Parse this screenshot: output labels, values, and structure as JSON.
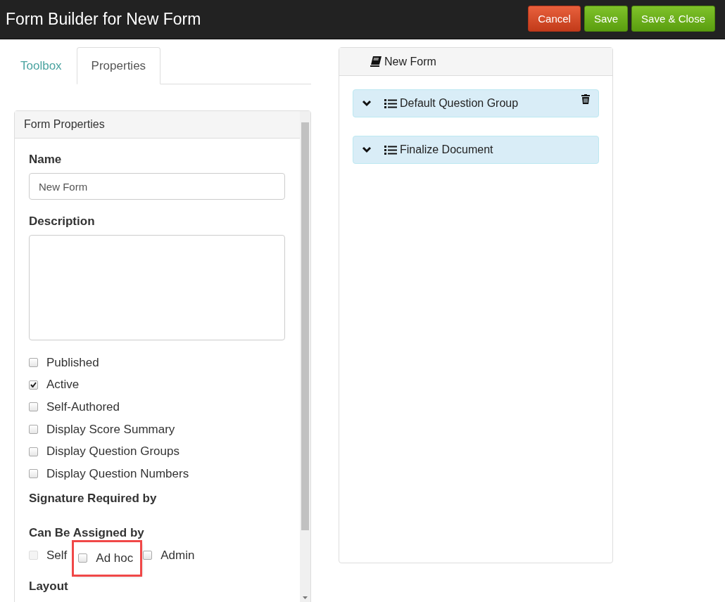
{
  "header": {
    "title": "Form Builder for New Form",
    "buttons": [
      {
        "label": "Cancel",
        "kind": "danger"
      },
      {
        "label": "Save",
        "kind": "success"
      },
      {
        "label": "Save & Close",
        "kind": "success"
      }
    ]
  },
  "tabs": [
    {
      "label": "Toolbox",
      "selected": false
    },
    {
      "label": "Properties",
      "selected": true
    }
  ],
  "properties_panel": {
    "title": "Form Properties",
    "name_field": {
      "label": "Name",
      "value": "New Form"
    },
    "description_field": {
      "label": "Description"
    },
    "options": [
      {
        "label": "Published",
        "checked": false
      },
      {
        "label": "Active",
        "checked": true
      },
      {
        "label": "Self-Authored",
        "checked": false
      },
      {
        "label": "Display Score Summary",
        "checked": false
      },
      {
        "label": "Display Question Groups",
        "checked": false
      },
      {
        "label": "Display Question Numbers",
        "checked": false
      }
    ],
    "signature_heading": "Signature Required by",
    "assigned_heading": "Can Be Assigned by",
    "assigned_options": [
      {
        "label": "Self",
        "checked": false,
        "disabled": true,
        "highlighted": false
      },
      {
        "label": "Ad hoc",
        "checked": false,
        "disabled": false,
        "highlighted": true
      },
      {
        "label": "Admin",
        "checked": false,
        "disabled": false,
        "highlighted": false
      }
    ],
    "layout_heading": "Layout"
  },
  "form_panel": {
    "title": "New Form",
    "groups": [
      {
        "label": "Default Question Group",
        "deletable": true
      },
      {
        "label": "Finalize Document",
        "deletable": false
      }
    ]
  }
}
